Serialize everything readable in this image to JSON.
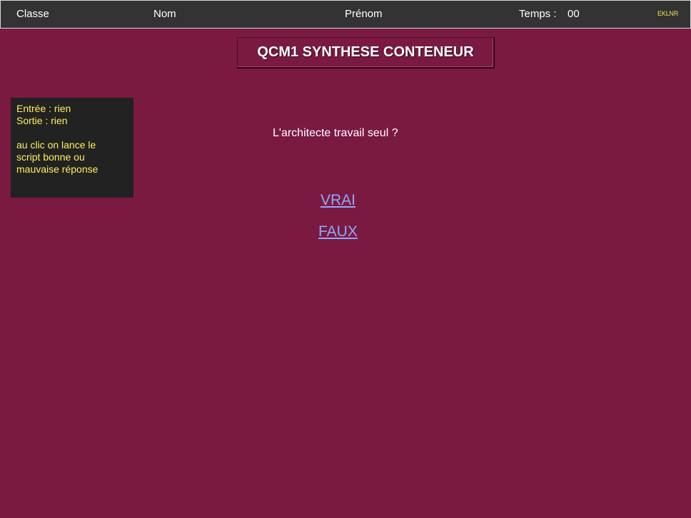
{
  "header": {
    "classe": "Classe",
    "nom": "Nom",
    "prenom": "Prénom",
    "temps_label": "Temps :",
    "temps_value": "00",
    "code": "EKLNR"
  },
  "title": "QCM1 SYNTHESE CONTENEUR",
  "note": {
    "entree": "Entrée : rien",
    "sortie": "Sortie : rien",
    "line1": "au clic on lance le",
    "line2": "script bonne ou",
    "line3": "mauvaise réponse"
  },
  "question": "L'architecte travail seul ?",
  "answers": {
    "vrai": "VRAI",
    "faux": "FAUX"
  },
  "colors": {
    "background": "#7b1a40",
    "header": "#333333",
    "note_bg": "#222222",
    "note_text": "#ffef5a",
    "link": "#8fa8ff"
  }
}
